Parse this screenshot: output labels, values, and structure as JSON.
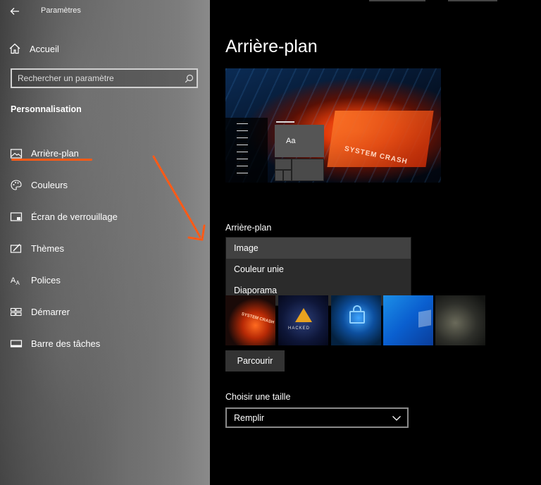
{
  "window": {
    "title": "Paramètres"
  },
  "sidebar": {
    "home_label": "Accueil",
    "search_placeholder": "Rechercher un paramètre",
    "section_title": "Personnalisation",
    "items": [
      {
        "label": "Arrière-plan",
        "icon": "image-icon"
      },
      {
        "label": "Couleurs",
        "icon": "palette-icon"
      },
      {
        "label": "Écran de verrouillage",
        "icon": "lock-screen-icon"
      },
      {
        "label": "Thèmes",
        "icon": "themes-icon"
      },
      {
        "label": "Polices",
        "icon": "fonts-icon"
      },
      {
        "label": "Démarrer",
        "icon": "start-icon"
      },
      {
        "label": "Barre des tâches",
        "icon": "taskbar-icon"
      }
    ],
    "selected_index": 0
  },
  "main": {
    "page_title": "Arrière-plan",
    "preview": {
      "tile_text": "Aa",
      "wallpaper_text": "SYSTEM CRASH"
    },
    "background_label": "Arrière-plan",
    "background_options": [
      "Image",
      "Couleur unie",
      "Diaporama"
    ],
    "background_selected": "Image",
    "thumbnails": [
      {
        "name": "system-crash",
        "text": "SYSTEM CRASH"
      },
      {
        "name": "hacked",
        "text": "HACKED"
      },
      {
        "name": "lock",
        "text": ""
      },
      {
        "name": "windows-blue",
        "text": ""
      },
      {
        "name": "soldier",
        "text": ""
      }
    ],
    "browse_label": "Parcourir",
    "size_label": "Choisir une taille",
    "size_value": "Remplir"
  },
  "colors": {
    "accent": "#ff5a16",
    "dropdown_bg": "#2b2b2b",
    "selected_option_bg": "#414141"
  }
}
